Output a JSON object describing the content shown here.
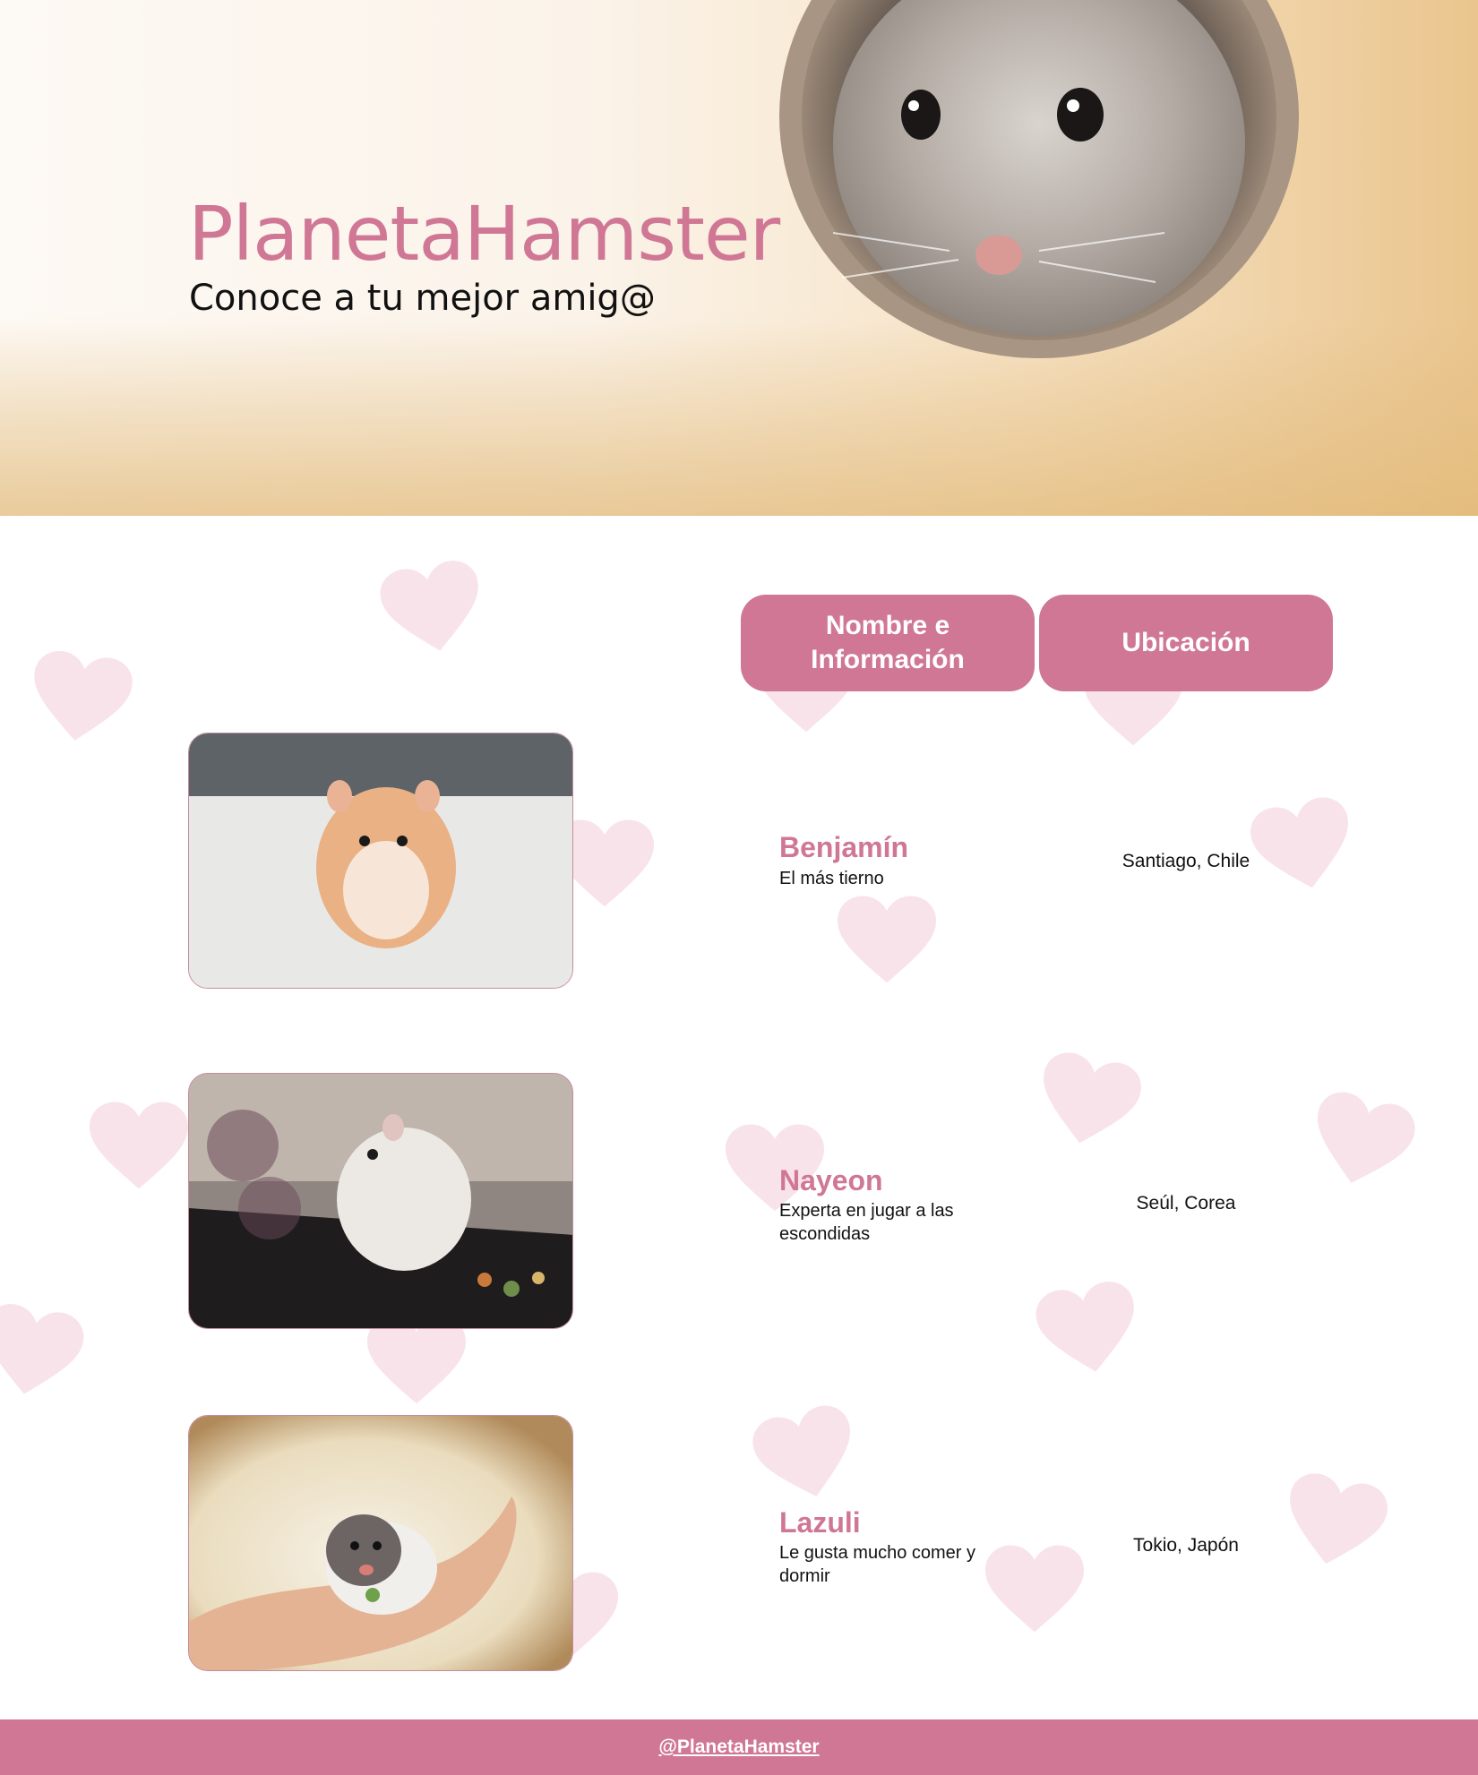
{
  "hero": {
    "title": "PlanetaHamster",
    "subtitle": "Conoce a tu mejor amig@"
  },
  "table": {
    "headers": {
      "name": "Nombre e Información",
      "location": "Ubicación"
    },
    "rows": [
      {
        "name": "Benjamín",
        "description": "El más tierno",
        "location": "Santiago, Chile"
      },
      {
        "name": "Nayeon",
        "description": "Experta en jugar a las escondidas",
        "location": "Seúl, Corea"
      },
      {
        "name": "Lazuli",
        "description": "Le gusta mucho comer y dormir",
        "location": "Tokio, Japón"
      }
    ]
  },
  "footer": {
    "handle": "@PlanetaHamster"
  },
  "colors": {
    "accent": "#cf7794",
    "heart": "#f8e3ea",
    "text": "#111111"
  }
}
